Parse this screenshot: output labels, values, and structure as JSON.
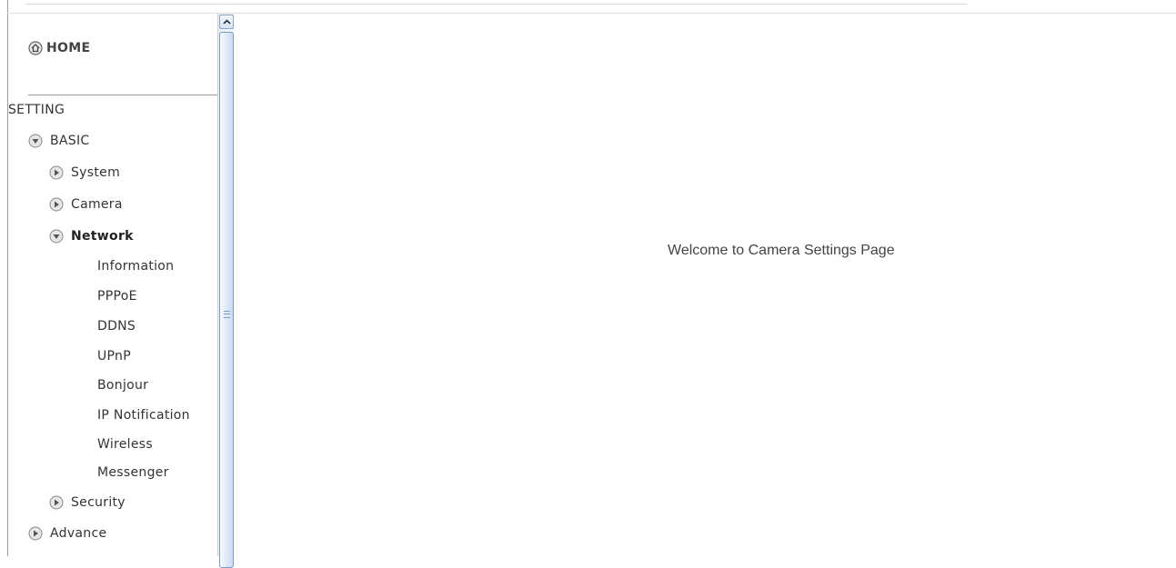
{
  "sidebar": {
    "home_label": "HOME",
    "setting_label": "SETTING",
    "basic_label": "BASIC",
    "system_label": "System",
    "camera_label": "Camera",
    "network_label": "Network",
    "network_items": [
      "Information",
      "PPPoE",
      "DDNS",
      "UPnP",
      "Bonjour",
      "IP Notification",
      "Wireless",
      "Messenger"
    ],
    "security_label": "Security",
    "advance_label": "Advance"
  },
  "content": {
    "welcome_text": "Welcome to Camera Settings Page"
  },
  "colors": {
    "text": "#333333",
    "scrollbar_thumb": "#c9daf0",
    "scrollbar_border": "#7c9ac3"
  }
}
